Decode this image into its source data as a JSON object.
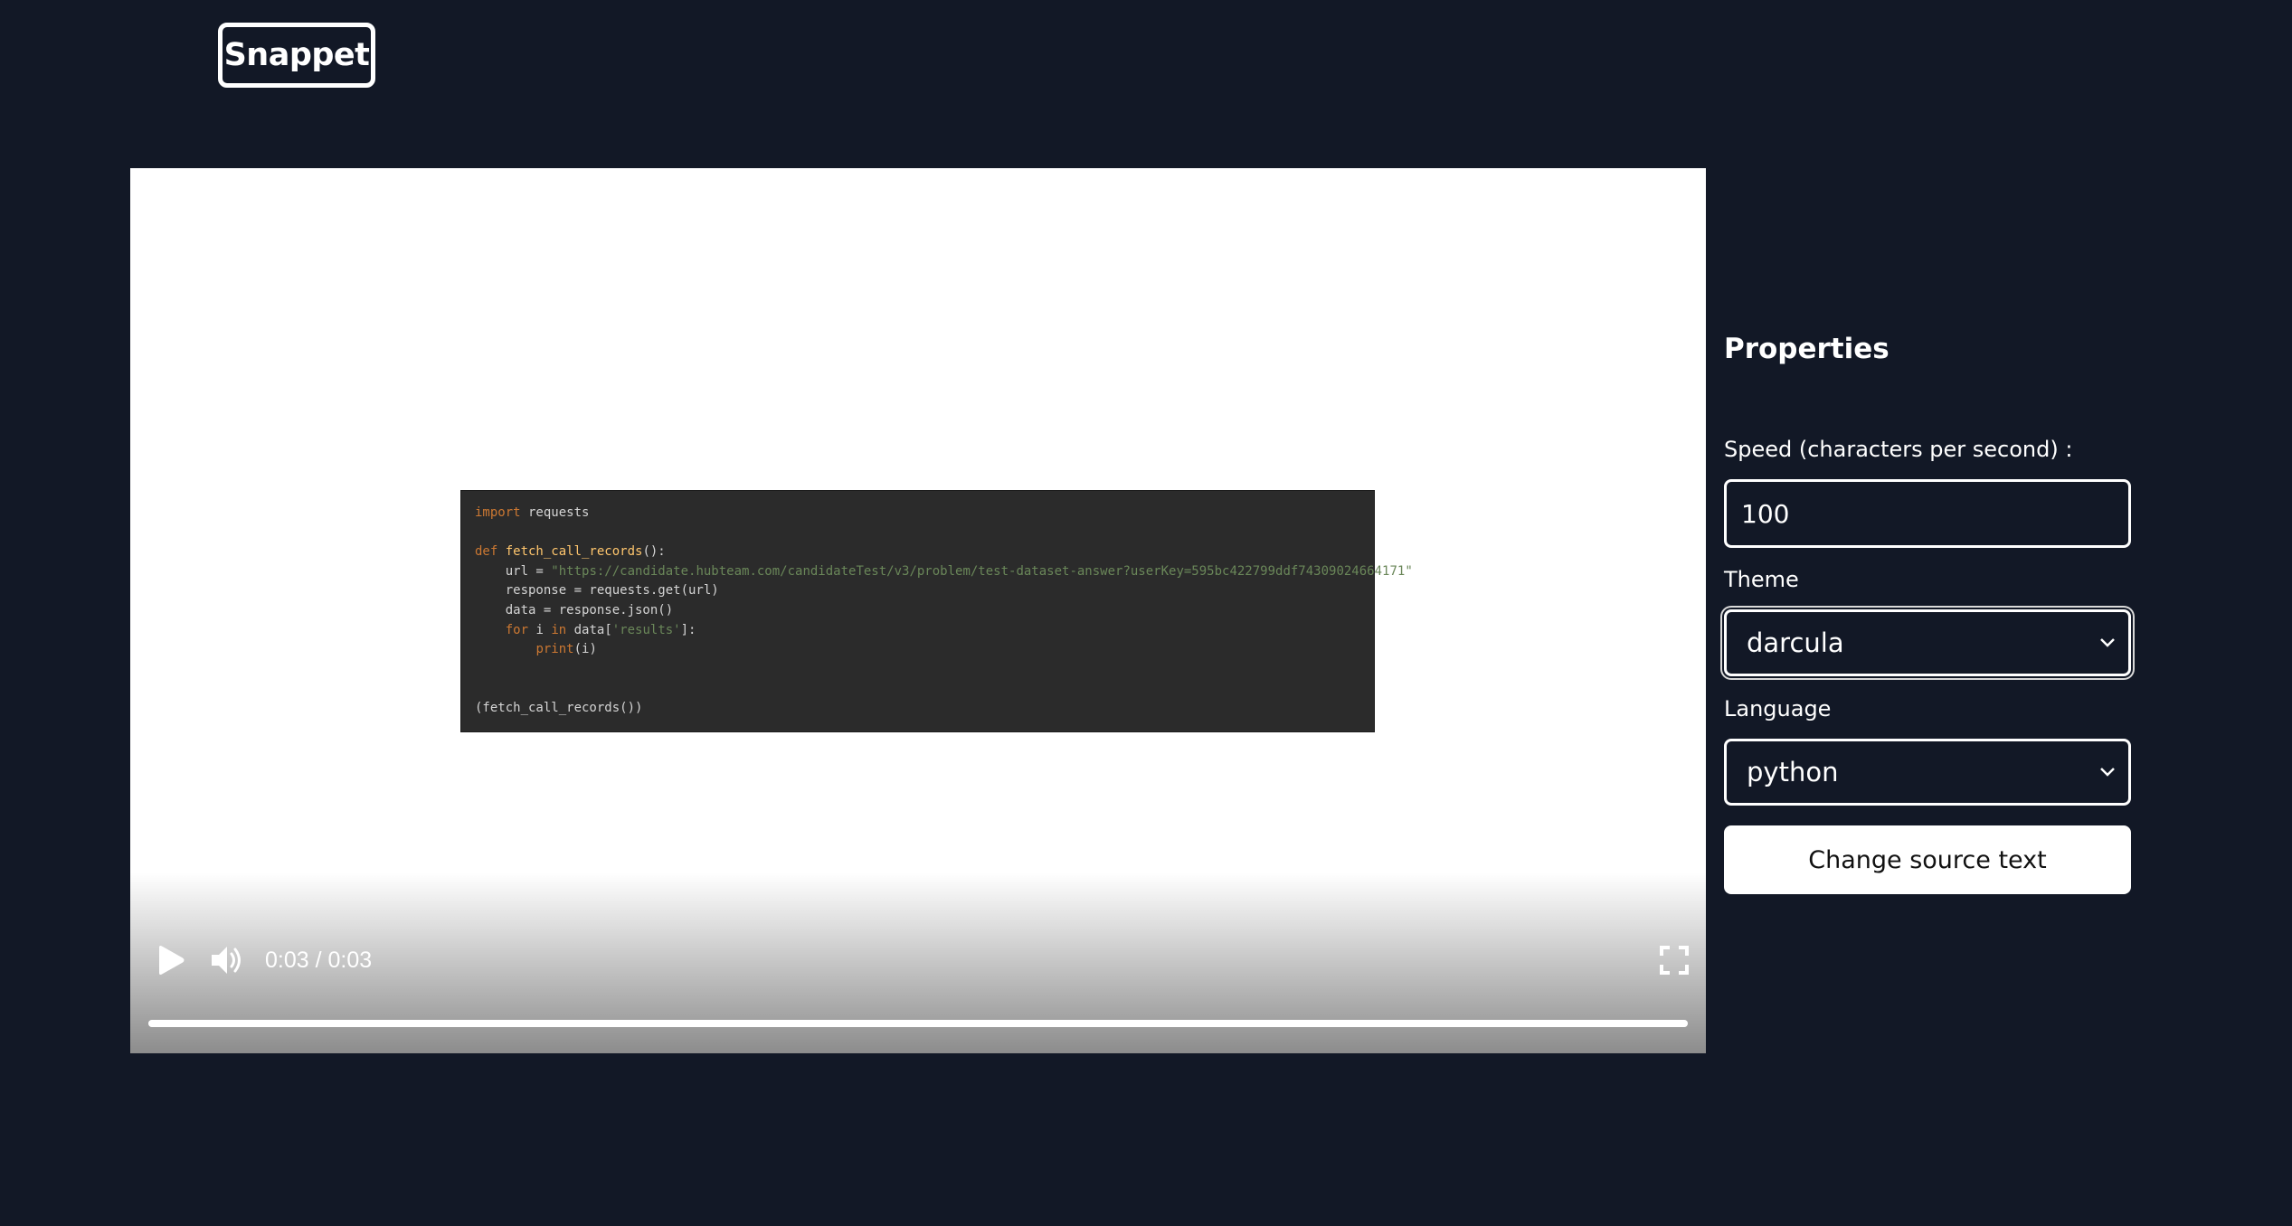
{
  "app": {
    "logo_text": "Snappet"
  },
  "video": {
    "code_lines": [
      [
        {
          "t": "import",
          "c": "kw"
        },
        {
          "t": " requests",
          "c": "plain"
        }
      ],
      [],
      [
        {
          "t": "def ",
          "c": "kw"
        },
        {
          "t": "fetch_call_records",
          "c": "fn"
        },
        {
          "t": "():",
          "c": "plain"
        }
      ],
      [
        {
          "t": "    url = ",
          "c": "plain"
        },
        {
          "t": "\"https://candidate.hubteam.com/candidateTest/v3/problem/test-dataset-answer?userKey=595bc422799ddf74309024664171\"",
          "c": "str"
        }
      ],
      [
        {
          "t": "    response = requests.get(url)",
          "c": "plain"
        }
      ],
      [
        {
          "t": "    data = response.json()",
          "c": "plain"
        }
      ],
      [
        {
          "t": "    ",
          "c": "plain"
        },
        {
          "t": "for",
          "c": "kw"
        },
        {
          "t": " i ",
          "c": "plain"
        },
        {
          "t": "in",
          "c": "kw"
        },
        {
          "t": " data[",
          "c": "plain"
        },
        {
          "t": "'results'",
          "c": "str"
        },
        {
          "t": "]:",
          "c": "plain"
        }
      ],
      [
        {
          "t": "        ",
          "c": "plain"
        },
        {
          "t": "print",
          "c": "kw"
        },
        {
          "t": "(i)",
          "c": "plain"
        }
      ],
      [],
      [],
      [
        {
          "t": "(fetch_call_records())",
          "c": "plain"
        }
      ]
    ],
    "time_display": "0:03 / 0:03",
    "progress": 1.0,
    "icons": {
      "play": "play-icon",
      "volume": "volume-icon",
      "fullscreen": "fullscreen-icon"
    }
  },
  "properties": {
    "title": "Properties",
    "speed_label": "Speed (characters per second) :",
    "speed_value": "100",
    "theme_label": "Theme",
    "theme_value": "darcula",
    "language_label": "Language",
    "language_value": "python",
    "change_button_label": "Change source text"
  }
}
